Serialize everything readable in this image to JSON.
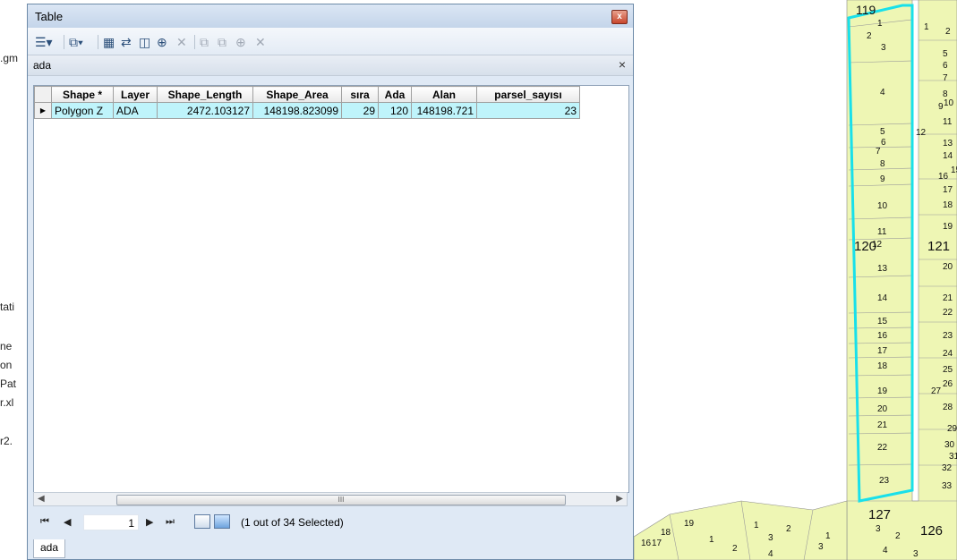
{
  "window": {
    "title": "Table",
    "close_glyph": "x"
  },
  "toolbar": {
    "icons": [
      "table-options-icon",
      "related-tables-icon",
      "select-by-attributes-icon",
      "switch-selection-icon",
      "clear-selection-icon",
      "zoom-to-selected-icon",
      "delete-selected-icon",
      "copy-icon",
      "paste-icon",
      "add-field-icon",
      "delete-field-icon"
    ]
  },
  "tab": {
    "name": "ada",
    "close_glyph": "×"
  },
  "table": {
    "columns": [
      "Shape *",
      "Layer",
      "Shape_Length",
      "Shape_Area",
      "sıra",
      "Ada",
      "Alan",
      "parsel_sayısı"
    ],
    "rows": [
      [
        "Polygon Z",
        "ADA",
        "2472.103127",
        "148198.823099",
        "29",
        "120",
        "148198.721",
        "23"
      ]
    ]
  },
  "scrollbar": {
    "grip": "III"
  },
  "navigator": {
    "current_record": "1",
    "status": "(1 out of 34 Selected)"
  },
  "bottom_tab": {
    "label": "ada"
  },
  "background_panel": {
    "fragments": [
      ".gm",
      "tati",
      "ne",
      "on",
      "Pat",
      "r.xl",
      "r2."
    ]
  },
  "map": {
    "parcel_fill": "#eef6b4",
    "highlight_color": "#19e0ea",
    "block_labels": [
      "119",
      "120",
      "121",
      "127",
      "126"
    ],
    "parcel_labels_left": [
      "1",
      "2",
      "3",
      "4",
      "5",
      "6",
      "7",
      "8",
      "9",
      "10",
      "11",
      "12",
      "13",
      "14",
      "15",
      "16",
      "17",
      "18",
      "19",
      "20",
      "21",
      "22",
      "23"
    ],
    "parcel_labels_right": [
      "1",
      "2",
      "5",
      "6",
      "7",
      "8",
      "9",
      "10",
      "11",
      "12",
      "13",
      "14",
      "15",
      "16",
      "17",
      "18",
      "19",
      "20",
      "21",
      "22",
      "23",
      "24",
      "25",
      "26",
      "27",
      "28",
      "29",
      "30",
      "31",
      "32",
      "33"
    ],
    "bottom_labels": [
      "19",
      "18",
      "16",
      "17",
      "1",
      "2",
      "3",
      "4",
      "2",
      "1",
      "1",
      "3",
      "2",
      "3",
      "4",
      "3"
    ]
  }
}
